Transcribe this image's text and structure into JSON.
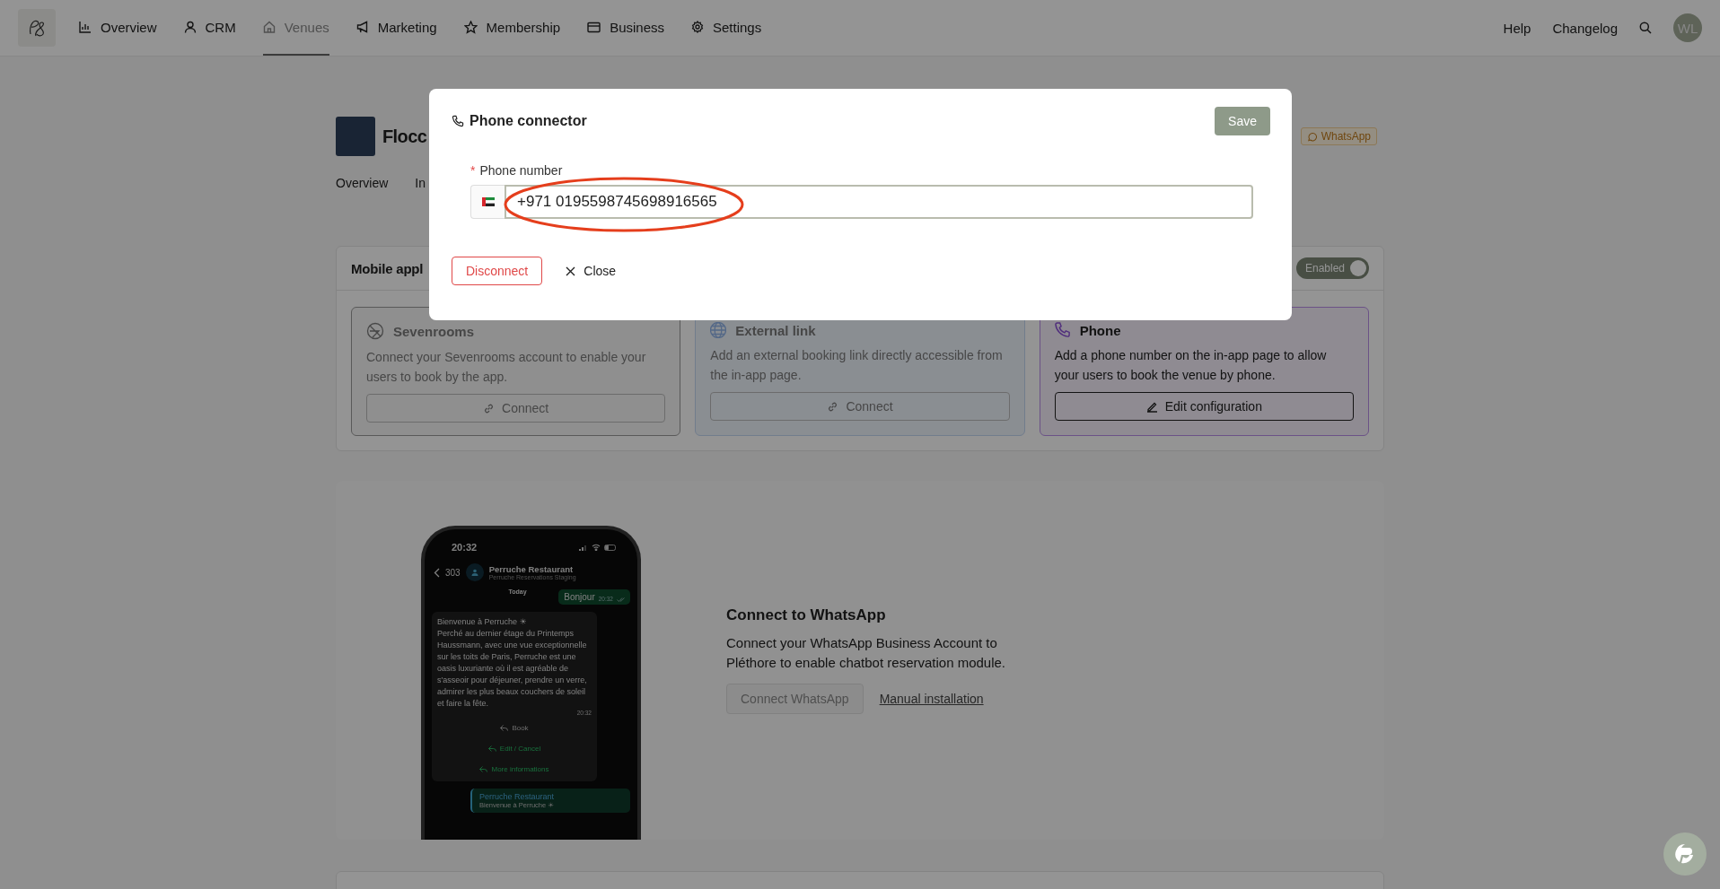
{
  "nav": {
    "items": [
      {
        "label": "Overview",
        "selected": false
      },
      {
        "label": "CRM",
        "selected": false
      },
      {
        "label": "Venues",
        "selected": true
      },
      {
        "label": "Marketing",
        "selected": false
      },
      {
        "label": "Membership",
        "selected": false
      },
      {
        "label": "Business",
        "selected": false
      },
      {
        "label": "Settings",
        "selected": false
      }
    ],
    "links": [
      "Help",
      "Changelog"
    ],
    "avatar": "WL"
  },
  "venue": {
    "name": "Flocc",
    "badge": "WhatsApp",
    "tabs": [
      "Overview",
      "In"
    ]
  },
  "mobile_app": {
    "title": "Mobile appl",
    "toggle": {
      "label": "Enabled",
      "on": true
    },
    "connectors": [
      {
        "kind": "sevenrooms",
        "title": "Sevenrooms",
        "description": "Connect your Sevenrooms account to enable your users to book by the app.",
        "button": "Connect",
        "active": false
      },
      {
        "kind": "globe",
        "title": "External link",
        "description": "Add an external booking link directly accessible from the in-app page.",
        "button": "Connect",
        "active": false
      },
      {
        "kind": "phone",
        "title": "Phone",
        "description": "Add a phone number on the in-app page to allow your users to book the venue by phone.",
        "button": "Edit configuration",
        "active": true
      }
    ]
  },
  "whatsapp": {
    "title": "Connect to WhatsApp",
    "description": "Connect your WhatsApp Business Account to Pléthore to enable chatbot reservation module.",
    "connect_button": "Connect WhatsApp",
    "manual_link": "Manual installation",
    "phone": {
      "time": "20:32",
      "back_count": "303",
      "contact": "Perruche Restaurant",
      "subtitle": "Perruche Reservations Staging",
      "day": "Today",
      "sent": {
        "text": "Bonjour",
        "time": "20:32"
      },
      "received": {
        "greeting": "Bienvenue à Perruche ☀",
        "text": "Perché au dernier étage du Printemps Haussmann, avec une vue exceptionnelle sur les toits de Paris, Perruche est une oasis luxuriante où il est agréable de s'asseoir pour déjeuner, prendre un verre, admirer les plus beaux couchers de soleil et faire la fête.",
        "time": "20:32"
      },
      "actions": [
        "Book",
        "Edit / Cancel",
        "More informations"
      ],
      "preview": {
        "title": "Perruche Restaurant",
        "text": "Bienvenue à Perruche ☀"
      }
    }
  },
  "modal": {
    "title": "Phone connector",
    "save": "Save",
    "field": {
      "label": "Phone number",
      "required_mark": "*",
      "value": "+971 0195598745698916565"
    },
    "disconnect": "Disconnect",
    "close": "Close"
  }
}
